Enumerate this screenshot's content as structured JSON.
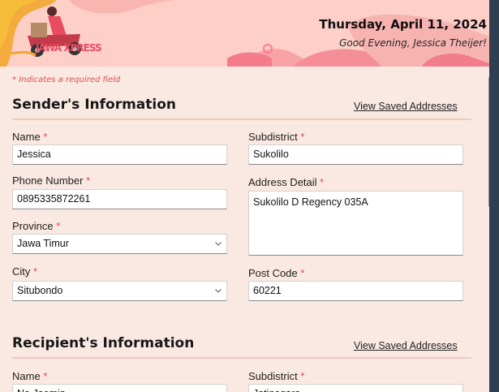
{
  "header": {
    "logo_text": "JAWA XPRESS",
    "date": "Thursday, April 11, 2024",
    "greeting": "Good Evening, Jessica Theijer!"
  },
  "required_note": "* Indicates a required field",
  "sender": {
    "title": "Sender's Information",
    "saved_link": "View Saved Addresses",
    "name_label": "Name",
    "name_value": "Jessica",
    "phone_label": "Phone Number",
    "phone_value": "0895335872261",
    "province_label": "Province",
    "province_value": "Jawa Timur",
    "city_label": "City",
    "city_value": "Situbondo",
    "subdistrict_label": "Subdistrict",
    "subdistrict_value": "Sukolilo",
    "address_label": "Address Detail",
    "address_value": "Sukolilo D Regency 035A",
    "postcode_label": "Post Code",
    "postcode_value": "60221"
  },
  "recipient": {
    "title": "Recipient's Information",
    "saved_link": "View Saved Addresses",
    "name_label": "Name",
    "name_value": "Na Jaemin",
    "subdistrict_label": "Subdistrict",
    "subdistrict_value": "Jatinegara"
  },
  "required_marker": "*",
  "colors": {
    "header_bg": "#fdcfc7",
    "page_bg": "#fae9e2",
    "required": "#e24a4a",
    "outer_bg": "#263547"
  }
}
